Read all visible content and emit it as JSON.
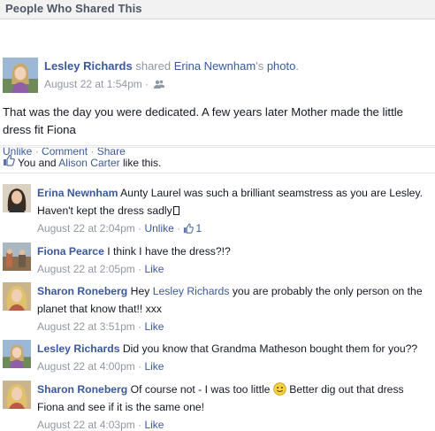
{
  "header": {
    "title": "People Who Shared This"
  },
  "post": {
    "author": "Lesley Richards",
    "shared_word": "shared",
    "owner": "Erina Newnham",
    "owner_suffix": "'s",
    "object": "photo",
    "period": ".",
    "timestamp": "August 22 at 1:54pm",
    "separator": "·",
    "text": "That was the day you were dedicated. A few years later Mother made the little dress fit Fiona",
    "actions": {
      "unlike": "Unlike",
      "comment": "Comment",
      "share": "Share"
    }
  },
  "likes": {
    "you": "You and",
    "other": "Alison Carter",
    "suffix": "like this."
  },
  "comments": [
    {
      "author": "Erina Newnham",
      "text": "Aunty Laurel was such a brilliant seamstress as you are Lesley. Haven't kept the dress sadly",
      "time": "August 22 at 2:04pm",
      "action": "Unlike",
      "like_count": "1"
    },
    {
      "author": "Fiona Pearce",
      "text": "I think I have the dress?!?",
      "time": "August 22 at 2:05pm",
      "action": "Like"
    },
    {
      "author": "Sharon Roneberg",
      "text_before": "Hey",
      "mention": "Lesley Richards",
      "text_after": "you are probably the only person on the planet that know that!! xxx",
      "time": "August 22 at 3:51pm",
      "action": "Like"
    },
    {
      "author": "Lesley Richards",
      "text": "Did you know that Grandma Matheson bought them for you??",
      "time": "August 22 at 4:00pm",
      "action": "Like"
    },
    {
      "author": "Sharon Roneberg",
      "text_before": "Of course not - I was too little",
      "text_after": "Better dig out that dress Fiona and see if it is the same one!",
      "time": "August 22 at 4:03pm",
      "action": "Like"
    }
  ],
  "colors": {
    "link": "#3b5998",
    "meta": "#9197a3",
    "text": "#141823",
    "header_bg": "#f2f2f2"
  },
  "icons": {
    "friends": "friends-icon",
    "like": "thumbs-up-icon",
    "smiley": "smiley-emoticon"
  }
}
